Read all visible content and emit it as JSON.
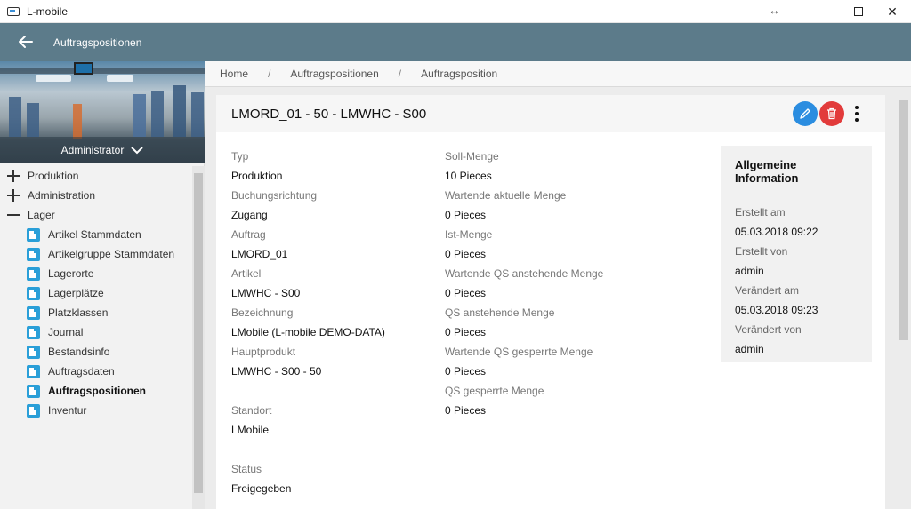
{
  "window": {
    "title": "L-mobile",
    "resize_glyph": "↔",
    "close_glyph": "✕"
  },
  "appbar": {
    "title": "Auftragspositionen"
  },
  "sidebar": {
    "user": "Administrator",
    "groups": [
      {
        "label": "Produktion",
        "expanded": false
      },
      {
        "label": "Administration",
        "expanded": false
      },
      {
        "label": "Lager",
        "expanded": true
      }
    ],
    "items": [
      {
        "label": "Artikel Stammdaten"
      },
      {
        "label": "Artikelgruppe Stammdaten"
      },
      {
        "label": "Lagerorte"
      },
      {
        "label": "Lagerplätze"
      },
      {
        "label": "Platzklassen"
      },
      {
        "label": "Journal"
      },
      {
        "label": "Bestandsinfo"
      },
      {
        "label": "Auftragsdaten"
      },
      {
        "label": "Auftragspositionen",
        "active": true
      },
      {
        "label": "Inventur"
      }
    ]
  },
  "breadcrumb": {
    "items": [
      "Home",
      "Auftragspositionen",
      "Auftragsposition"
    ],
    "separator": "/"
  },
  "record": {
    "title": "LMORD_01 - 50 - LMWHC - S00",
    "col1": [
      {
        "label": "Typ",
        "value": "Produktion"
      },
      {
        "label": "Buchungsrichtung",
        "value": "Zugang"
      },
      {
        "label": "Auftrag",
        "value": "LMORD_01"
      },
      {
        "label": "Artikel",
        "value": "LMWHC - S00"
      },
      {
        "label": "Bezeichnung",
        "value": "LMobile (L-mobile DEMO-DATA)"
      },
      {
        "label": "Hauptprodukt",
        "value": "LMWHC - S00 - 50"
      },
      {
        "label": "Standort",
        "value": "LMobile"
      },
      {
        "label": "Status",
        "value": "Freigegeben"
      }
    ],
    "col2": [
      {
        "label": "Soll-Menge",
        "value": "10 Pieces"
      },
      {
        "label": "Wartende aktuelle Menge",
        "value": "0 Pieces"
      },
      {
        "label": "Ist-Menge",
        "value": "0 Pieces"
      },
      {
        "label": "Wartende QS anstehende Menge",
        "value": "0 Pieces"
      },
      {
        "label": "QS anstehende Menge",
        "value": "0 Pieces"
      },
      {
        "label": "Wartende QS gesperrte Menge",
        "value": "0 Pieces"
      },
      {
        "label": "QS gesperrte Menge",
        "value": "0 Pieces"
      }
    ]
  },
  "info": {
    "title": "Allgemeine Information",
    "fields": [
      {
        "label": "Erstellt am",
        "value": "05.03.2018 09:22"
      },
      {
        "label": "Erstellt von",
        "value": "admin"
      },
      {
        "label": "Verändert am",
        "value": "05.03.2018 09:23"
      },
      {
        "label": "Verändert von",
        "value": "admin"
      }
    ]
  },
  "colors": {
    "appbar": "#5c7b8a",
    "edit_button": "#2b8de0",
    "delete_button": "#e23b3b",
    "nav_icon": "#2a9fd8"
  }
}
